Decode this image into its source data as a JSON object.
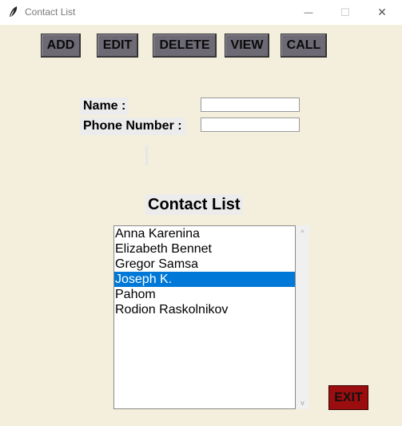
{
  "window": {
    "title": "Contact List",
    "minimize_glyph": "—",
    "maximize_glyph": "☐",
    "close_glyph": "✕"
  },
  "toolbar": {
    "add": "ADD",
    "edit": "EDIT",
    "delete": "DELETE",
    "view": "VIEW",
    "call": "CALL"
  },
  "form": {
    "name_label": "Name :",
    "name_value": "",
    "phone_label": "Phone Number :",
    "phone_value": ""
  },
  "list": {
    "heading": "Contact List",
    "items": [
      "Anna Karenina",
      "Elizabeth Bennet",
      "Gregor Samsa",
      "Joseph K.",
      "Pahom",
      "Rodion Raskolnikov"
    ],
    "selected": "Joseph K."
  },
  "scroll": {
    "up_glyph": "^",
    "down_glyph": "v"
  },
  "exit_label": "EXIT",
  "colors": {
    "background": "#f3efdc",
    "button": "#6d6a75",
    "exit_button": "#9c0d10",
    "selection": "#0078d7"
  }
}
